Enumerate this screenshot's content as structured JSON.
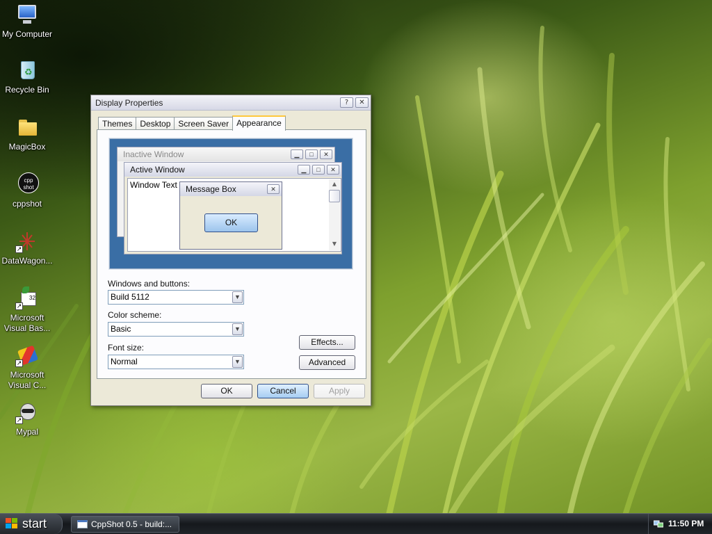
{
  "desktop": {
    "icons": [
      {
        "label": "My Computer",
        "icon": "computer-icon"
      },
      {
        "label": "Recycle Bin",
        "icon": "recycle-bin-icon"
      },
      {
        "label": "MagicBox",
        "icon": "folder-icon"
      },
      {
        "label": "cppshot",
        "icon": "cppshot-app-icon",
        "icon_text": "cpp shot"
      },
      {
        "label": "DataWagon...",
        "icon": "datawagon-app-icon"
      },
      {
        "label": "Microsoft Visual Bas...",
        "line1": "Microsoft",
        "line2": "Visual Bas...",
        "icon": "visual-basic-icon"
      },
      {
        "label": "Microsoft Visual C...",
        "line1": "Microsoft",
        "line2": "Visual C...",
        "icon": "visual-c-icon"
      },
      {
        "label": "Mypal",
        "icon": "mypal-browser-icon"
      }
    ]
  },
  "dialog": {
    "title": "Display Properties",
    "help_glyph": "?",
    "close_glyph": "✕",
    "tabs": [
      {
        "label": "Themes",
        "active": false
      },
      {
        "label": "Desktop",
        "active": false
      },
      {
        "label": "Screen Saver",
        "active": false
      },
      {
        "label": "Appearance",
        "active": true
      }
    ],
    "preview": {
      "inactive_title": "Inactive Window",
      "active_title": "Active Window",
      "window_text": "Window Text",
      "message_box_title": "Message Box",
      "message_box_ok": "OK"
    },
    "windows_buttons_label": "Windows and buttons:",
    "windows_buttons_value": "Build 5112",
    "color_scheme_label": "Color scheme:",
    "color_scheme_value": "Basic",
    "font_size_label": "Font size:",
    "font_size_value": "Normal",
    "effects_button": "Effects...",
    "advanced_button": "Advanced",
    "ok_button": "OK",
    "cancel_button": "Cancel",
    "apply_button": "Apply"
  },
  "taskbar": {
    "start_label": "start",
    "task_item": "CppShot 0.5 - build:...",
    "clock": "11:50 PM"
  },
  "colors": {
    "preview_desktop": "#3a6ea5",
    "dialog_face": "#ece9d8",
    "accent_tab": "#ffc83c"
  }
}
